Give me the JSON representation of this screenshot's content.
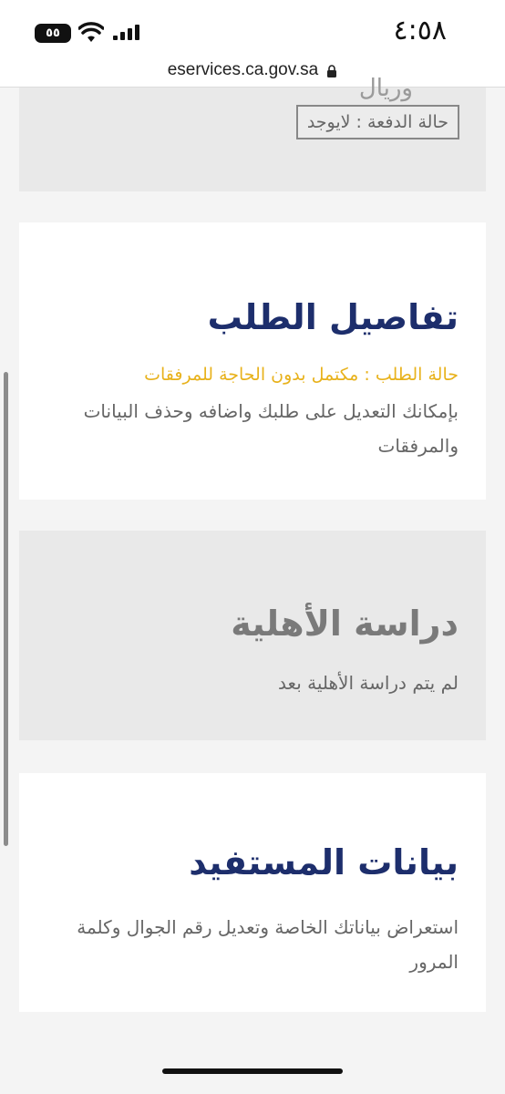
{
  "status_bar": {
    "time": "٤:٥٨",
    "battery": "٥٥"
  },
  "browser": {
    "url": "eservices.ca.gov.sa"
  },
  "payment_card": {
    "faded_text": "وريال",
    "payment_status": "حالة الدفعة : لايوجد"
  },
  "request_details": {
    "title": "تفاصيل الطلب",
    "status": "حالة الطلب : مكتمل بدون الحاجة للمرفقات",
    "description": "بإمكانك التعديل على طلبك واضافه وحذف البيانات والمرفقات"
  },
  "eligibility": {
    "title": "دراسة الأهلية",
    "description": "لم يتم دراسة الأهلية بعد"
  },
  "beneficiary": {
    "title": "بيانات المستفيد",
    "description": "استعراض بياناتك الخاصة وتعديل رقم الجوال وكلمة المرور"
  },
  "colors": {
    "primary_blue": "#1d2e6c",
    "status_yellow": "#e8b21c",
    "grey_card": "#e9e9e9"
  }
}
